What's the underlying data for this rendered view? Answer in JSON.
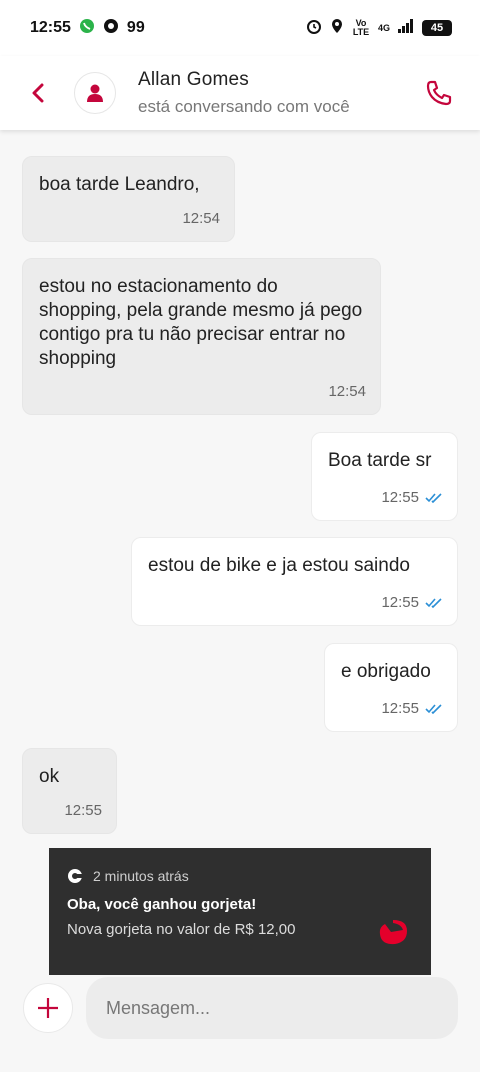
{
  "status_bar": {
    "time": "12:55",
    "badge": "99",
    "network": "4G",
    "volte": "Vo LTE",
    "battery": "45"
  },
  "header": {
    "contact_name": "Allan Gomes",
    "contact_status": "está conversando com você"
  },
  "messages": [
    {
      "text": "boa tarde Leandro,",
      "time": "12:54",
      "direction": "in"
    },
    {
      "text": "estou no estacionamento do shopping, pela grande mesmo já pego contigo pra tu não precisar entrar no shopping",
      "time": "12:54",
      "direction": "in"
    },
    {
      "text": "Boa tarde sr",
      "time": "12:55",
      "direction": "out",
      "read": true
    },
    {
      "text": "estou de bike e ja estou saindo",
      "time": "12:55",
      "direction": "out",
      "read": true
    },
    {
      "text": "e obrigado",
      "time": "12:55",
      "direction": "out",
      "read": true
    },
    {
      "text": "ok",
      "time": "12:55",
      "direction": "in"
    }
  ],
  "notification": {
    "time_ago": "2 minutos atrás",
    "title": "Oba, você ganhou gorjeta!",
    "body": "Nova gorjeta no valor de R$ 12,00"
  },
  "composer": {
    "placeholder": "Mensagem..."
  },
  "colors": {
    "accent": "#c4063c",
    "read_check": "#2b8fd6",
    "incoming_bubble": "#ececec",
    "outgoing_bubble": "#ffffff"
  }
}
